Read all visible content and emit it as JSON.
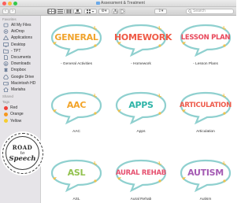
{
  "window": {
    "title": "Assessment & Treatment"
  },
  "toolbar": {
    "back": "‹",
    "forward": "›",
    "action_menu": "⚙▾",
    "share_menu": "⇪▾",
    "search_placeholder": "Search"
  },
  "sidebar": {
    "favorites_heading": "Favorites",
    "favorites": [
      {
        "label": "All My Files",
        "icon": "all-files-icon"
      },
      {
        "label": "AirDrop",
        "icon": "airdrop-icon"
      },
      {
        "label": "Applications",
        "icon": "applications-icon"
      },
      {
        "label": "Desktop",
        "icon": "desktop-icon"
      },
      {
        "label": "- TPT",
        "icon": "folder-icon"
      },
      {
        "label": "Documents",
        "icon": "documents-icon"
      },
      {
        "label": "Downloads",
        "icon": "downloads-icon"
      },
      {
        "label": "Dropbox",
        "icon": "dropbox-icon"
      },
      {
        "label": "Google Drive",
        "icon": "google-drive-icon"
      },
      {
        "label": "Macintosh HD",
        "icon": "hard-drive-icon"
      },
      {
        "label": "Mariaha",
        "icon": "home-icon"
      }
    ],
    "shared_heading": "Shared",
    "tags_heading": "Tags",
    "tags": [
      {
        "label": "Red",
        "color": "#f0413a"
      },
      {
        "label": "Orange",
        "color": "#f6981f"
      },
      {
        "label": "Yellow",
        "color": "#f7cd2f"
      }
    ]
  },
  "folders": [
    {
      "bubble_text": "GENERAL",
      "caption": "- General Activities",
      "color": "#f0a32c"
    },
    {
      "bubble_text": "HOMEWORK",
      "caption": "- Homework",
      "color": "#ef5a46"
    },
    {
      "bubble_text": "LESSON PLAN",
      "caption": "- Lesson Plans",
      "color": "#e8485b"
    },
    {
      "bubble_text": "AAC",
      "caption": "AAC",
      "color": "#f3a428"
    },
    {
      "bubble_text": "APPS",
      "caption": "Apps",
      "color": "#2fb4a8"
    },
    {
      "bubble_text": "ARTICULATION",
      "caption": "Articulation",
      "color": "#ee5a4a"
    },
    {
      "bubble_text": "ASL",
      "caption": "ASL",
      "color": "#92c24f"
    },
    {
      "bubble_text": "AURAL REHAB",
      "caption": "Aural Rehab",
      "color": "#e6506f"
    },
    {
      "bubble_text": "AUTISM",
      "caption": "Autism",
      "color": "#a45bb3"
    }
  ],
  "colors": {
    "bubble_outline": "#8fd0cf",
    "bubble_accent": "#f1c24a"
  },
  "watermark": {
    "line1": "ROAD",
    "line2": "to",
    "line3": "Speech"
  }
}
